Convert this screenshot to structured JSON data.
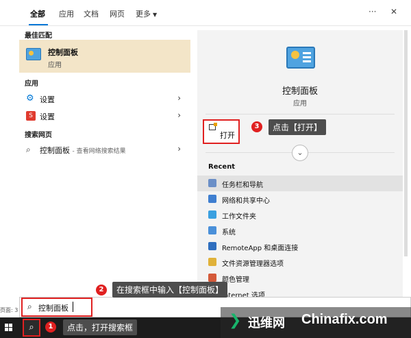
{
  "tabs": [
    "全部",
    "应用",
    "文档",
    "网页",
    "更多"
  ],
  "best_match": {
    "label": "最佳匹配",
    "title": "控制面板",
    "subtitle": "应用"
  },
  "apps": {
    "label": "应用",
    "items": [
      "设置",
      "设置"
    ]
  },
  "web": {
    "label": "搜索网页",
    "query": "控制面板",
    "suffix": "- 查看网络搜索结果"
  },
  "detail": {
    "title": "控制面板",
    "subtitle": "应用",
    "open_label": "打开",
    "recent_label": "Recent",
    "recent": [
      "任务栏和导航",
      "网络和共享中心",
      "工作文件夹",
      "系统",
      "RemoteApp 和桌面连接",
      "文件资源管理器选项",
      "颜色管理",
      "Internet 选项"
    ]
  },
  "search": {
    "value": "控制面板",
    "page_label": "页面: 3"
  },
  "callouts": {
    "c1": "点击，打开搜索框",
    "c2": "在搜索框中输入【控制面板】",
    "c3": "点击【打开】"
  },
  "badges": {
    "b1": "1",
    "b2": "2",
    "b3": "3"
  },
  "watermark": {
    "cn": "迅维网",
    "en": "Chinafix.com"
  },
  "colors": {
    "accent": "#0078d7",
    "highlight": "#f3e5c8",
    "annotation_red": "#e02020",
    "watermark_green": "#18b46b"
  },
  "icons": [
    "ellipsis-icon",
    "close-icon",
    "gear-icon",
    "search-icon",
    "open-icon",
    "chevron-down-icon",
    "windows-icon"
  ]
}
